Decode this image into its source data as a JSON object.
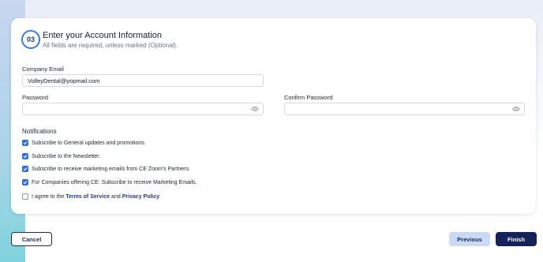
{
  "step": {
    "number": "03",
    "title": "Enter your Account Information",
    "subtitle": "All fields are required, unless marked (Optional)."
  },
  "company_email": {
    "label": "Company Email",
    "value": "VolleyDental@yopmail.com"
  },
  "password": {
    "label": "Password",
    "value": ""
  },
  "confirm_password": {
    "label": "Confirm Password",
    "value": ""
  },
  "notifications": {
    "title": "Notifications",
    "options": [
      {
        "label": "Subscribe to General updates and promotions.",
        "checked": true
      },
      {
        "label": "Subscribe to the Newsletter.",
        "checked": true
      },
      {
        "label": "Subscribe to receive marketing emails from CE Zoom's Partners.",
        "checked": true
      },
      {
        "label": "For Companies offering CE: Subscribe to receive Marketing Emails.",
        "checked": true
      }
    ]
  },
  "terms": {
    "checked": false,
    "prefix": "I agree to the ",
    "terms_link": "Terms of Service",
    "and": " and ",
    "privacy_link": "Privacy Policy"
  },
  "buttons": {
    "cancel": "Cancel",
    "previous": "Previous",
    "finish": "Finish"
  },
  "colors": {
    "accent": "#2f6fd6",
    "primary_dark": "#15225a",
    "secondary_light": "#c9d9f6"
  }
}
